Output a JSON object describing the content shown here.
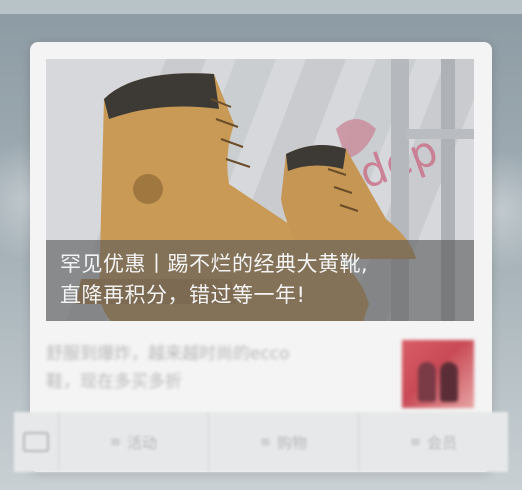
{
  "card": {
    "caption_line1": "罕见优惠丨踢不烂的经典大黄靴,",
    "caption_line2": "直降再积分，错过等一年!",
    "image_icon": "timberland-boots-photo"
  },
  "article": {
    "title_line1": "舒服到爆炸，越来越时尚的ecco",
    "title_line2": "鞋，现在多买多折"
  },
  "bottom_bar": {
    "keyboard_icon": "keyboard-icon",
    "tabs": [
      {
        "label": "活动"
      },
      {
        "label": "购物"
      },
      {
        "label": "会员"
      }
    ]
  },
  "colors": {
    "caption_bg": "#5a5a5a",
    "card_bg": "#f4f4f4",
    "thumb_accent": "#d85d66"
  }
}
